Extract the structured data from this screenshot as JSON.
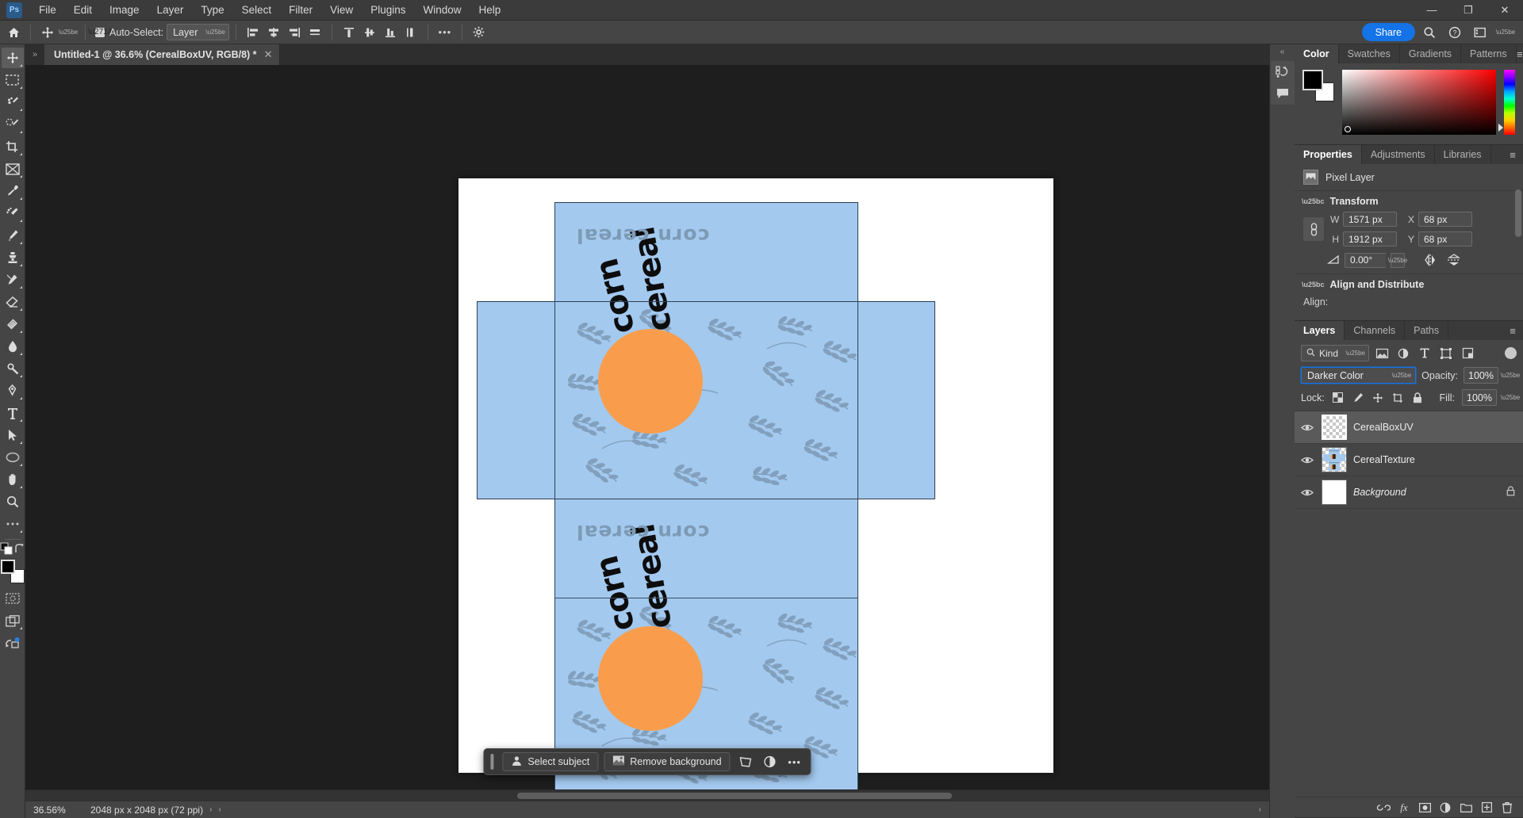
{
  "app": {
    "name": "Adobe Photoshop",
    "logo_text": "Ps",
    "accent": "#1473e6"
  },
  "menubar": {
    "items": [
      "File",
      "Edit",
      "Image",
      "Layer",
      "Type",
      "Select",
      "Filter",
      "View",
      "Plugins",
      "Window",
      "Help"
    ],
    "window_controls": {
      "minimize": "—",
      "maximize": "❐",
      "close": "✕"
    }
  },
  "options_bar": {
    "home_icon": "home-icon",
    "tool_icon": "move-tool-icon",
    "auto_select_label": "Auto-Select:",
    "auto_select_checked": true,
    "auto_select_scope": "Layer",
    "align_icons": [
      "align-left-edges-icon",
      "align-horizontal-centers-icon",
      "align-right-edges-icon",
      "distribute-horizontally-icon",
      "align-top-edges-icon",
      "align-vertical-centers-icon",
      "align-bottom-edges-icon",
      "distribute-vertically-icon"
    ],
    "more_label": "•••",
    "settings_icon": "gear-icon",
    "share_label": "Share",
    "search_icon": "search-icon",
    "help_icon": "help-icon",
    "workspace_icon": "workspace-icon"
  },
  "toolbar": {
    "collapse_label": "»",
    "tools": [
      {
        "name": "move-tool",
        "label": "Move Tool",
        "active": true
      },
      {
        "name": "rectangular-marquee-tool",
        "label": "Rectangular Marquee Tool"
      },
      {
        "name": "object-selection-tool",
        "label": "Object Selection Tool"
      },
      {
        "name": "lasso-tool",
        "label": "Lasso Tool"
      },
      {
        "name": "crop-tool",
        "label": "Crop Tool"
      },
      {
        "name": "frame-tool",
        "label": "Frame Tool"
      },
      {
        "name": "eyedropper-tool",
        "label": "Eyedropper Tool"
      },
      {
        "name": "spot-healing-brush-tool",
        "label": "Spot Healing Brush Tool"
      },
      {
        "name": "brush-tool",
        "label": "Brush Tool"
      },
      {
        "name": "clone-stamp-tool",
        "label": "Clone Stamp Tool"
      },
      {
        "name": "history-brush-tool",
        "label": "History Brush Tool"
      },
      {
        "name": "eraser-tool",
        "label": "Eraser Tool"
      },
      {
        "name": "gradient-tool",
        "label": "Gradient Tool"
      },
      {
        "name": "blur-tool",
        "label": "Blur Tool"
      },
      {
        "name": "dodge-tool",
        "label": "Dodge Tool"
      },
      {
        "name": "pen-tool",
        "label": "Pen Tool"
      },
      {
        "name": "type-tool",
        "label": "Horizontal Type Tool"
      },
      {
        "name": "path-selection-tool",
        "label": "Path Selection Tool"
      },
      {
        "name": "ellipse-tool",
        "label": "Ellipse Tool"
      },
      {
        "name": "hand-tool",
        "label": "Hand Tool"
      },
      {
        "name": "zoom-tool",
        "label": "Zoom Tool"
      },
      {
        "name": "edit-toolbar",
        "label": "Edit Toolbar"
      }
    ],
    "foreground_color": "#000000",
    "background_color": "#ffffff",
    "quick_mask_icon": "quick-mask-icon",
    "screen_mode_icon": "screen-mode-icon",
    "share_image_icon": "share-image-icon"
  },
  "document": {
    "tab_title": "Untitled-1 @ 36.6% (CerealBoxUV, RGB/8) *",
    "close_glyph": "✕",
    "collapse_glyph": "»"
  },
  "canvas": {
    "artwork_title": "corn cereal",
    "logo_line_1": "corn",
    "logo_line_2": "cereal",
    "colors": {
      "paper": "#ffffff",
      "box_blue": "#a3c9ef",
      "orange": "#f99d4c",
      "wheat_gray": "#7d9ab5",
      "logo_black": "#0d0d0d",
      "uv_outline": "#2d3f52"
    }
  },
  "contextual_task_bar": {
    "select_subject_label": "Select subject",
    "remove_background_label": "Remove background",
    "transform_icon": "transform-icon",
    "adjustment_icon": "adjustment-layer-icon",
    "more_label": "•••"
  },
  "status_bar": {
    "zoom": "36.56%",
    "doc_size": "2048 px x 2048 px (72 ppi)",
    "expand_glyph": "›",
    "collapse_glyph": "‹"
  },
  "mini_dock": {
    "collapse_glyph": "«",
    "icons": [
      "history-icon",
      "comments-icon"
    ]
  },
  "color_panel": {
    "tabs": [
      {
        "label": "Color",
        "active": true
      },
      {
        "label": "Swatches",
        "active": false
      },
      {
        "label": "Gradients",
        "active": false
      },
      {
        "label": "Patterns",
        "active": false
      }
    ],
    "menu_glyph": "≡",
    "foreground": "#000000",
    "background": "#ffffff"
  },
  "properties_panel": {
    "tabs": [
      {
        "label": "Properties",
        "active": true
      },
      {
        "label": "Adjustments",
        "active": false
      },
      {
        "label": "Libraries",
        "active": false
      }
    ],
    "menu_glyph": "≡",
    "layer_kind": "Pixel Layer",
    "transform": {
      "section_label": "Transform",
      "w_label": "W",
      "w_value": "1571 px",
      "h_label": "H",
      "h_value": "1912 px",
      "x_label": "X",
      "x_value": "68 px",
      "y_label": "Y",
      "y_value": "68 px",
      "angle_value": "0.00°",
      "link_icon": "link-constrain-icon",
      "flip_horizontal_icon": "flip-horizontal-icon",
      "flip_vertical_icon": "flip-vertical-icon"
    },
    "align_and_distribute": {
      "section_label": "Align and Distribute",
      "align_label": "Align:"
    }
  },
  "layers_panel": {
    "tabs": [
      {
        "label": "Layers",
        "active": true
      },
      {
        "label": "Channels",
        "active": false
      },
      {
        "label": "Paths",
        "active": false
      }
    ],
    "menu_glyph": "≡",
    "filter_kind_label": "Kind",
    "filter_icons": [
      "filter-pixel-icon",
      "filter-adjustment-icon",
      "filter-type-icon",
      "filter-shape-icon",
      "filter-smart-object-icon"
    ],
    "blend_mode": "Darker Color",
    "opacity_label": "Opacity:",
    "opacity_value": "100%",
    "lock_label": "Lock:",
    "lock_icons": [
      "lock-transparent-pixels-icon",
      "lock-image-pixels-icon",
      "lock-position-icon",
      "lock-artboard-nesting-icon",
      "lock-all-icon"
    ],
    "fill_label": "Fill:",
    "fill_value": "100%",
    "layers": [
      {
        "name": "CerealBoxUV",
        "visible": true,
        "selected": true,
        "locked": false,
        "thumb": "transparent",
        "italic": false
      },
      {
        "name": "CerealTexture",
        "visible": true,
        "selected": false,
        "locked": false,
        "thumb": "texture",
        "italic": false
      },
      {
        "name": "Background",
        "visible": true,
        "selected": false,
        "locked": true,
        "thumb": "white",
        "italic": true
      }
    ],
    "footer_icons": [
      "link-layers-icon",
      "layer-style-icon",
      "layer-mask-icon",
      "new-fill-adjustment-icon",
      "new-group-icon",
      "new-layer-icon",
      "delete-layer-icon"
    ]
  }
}
